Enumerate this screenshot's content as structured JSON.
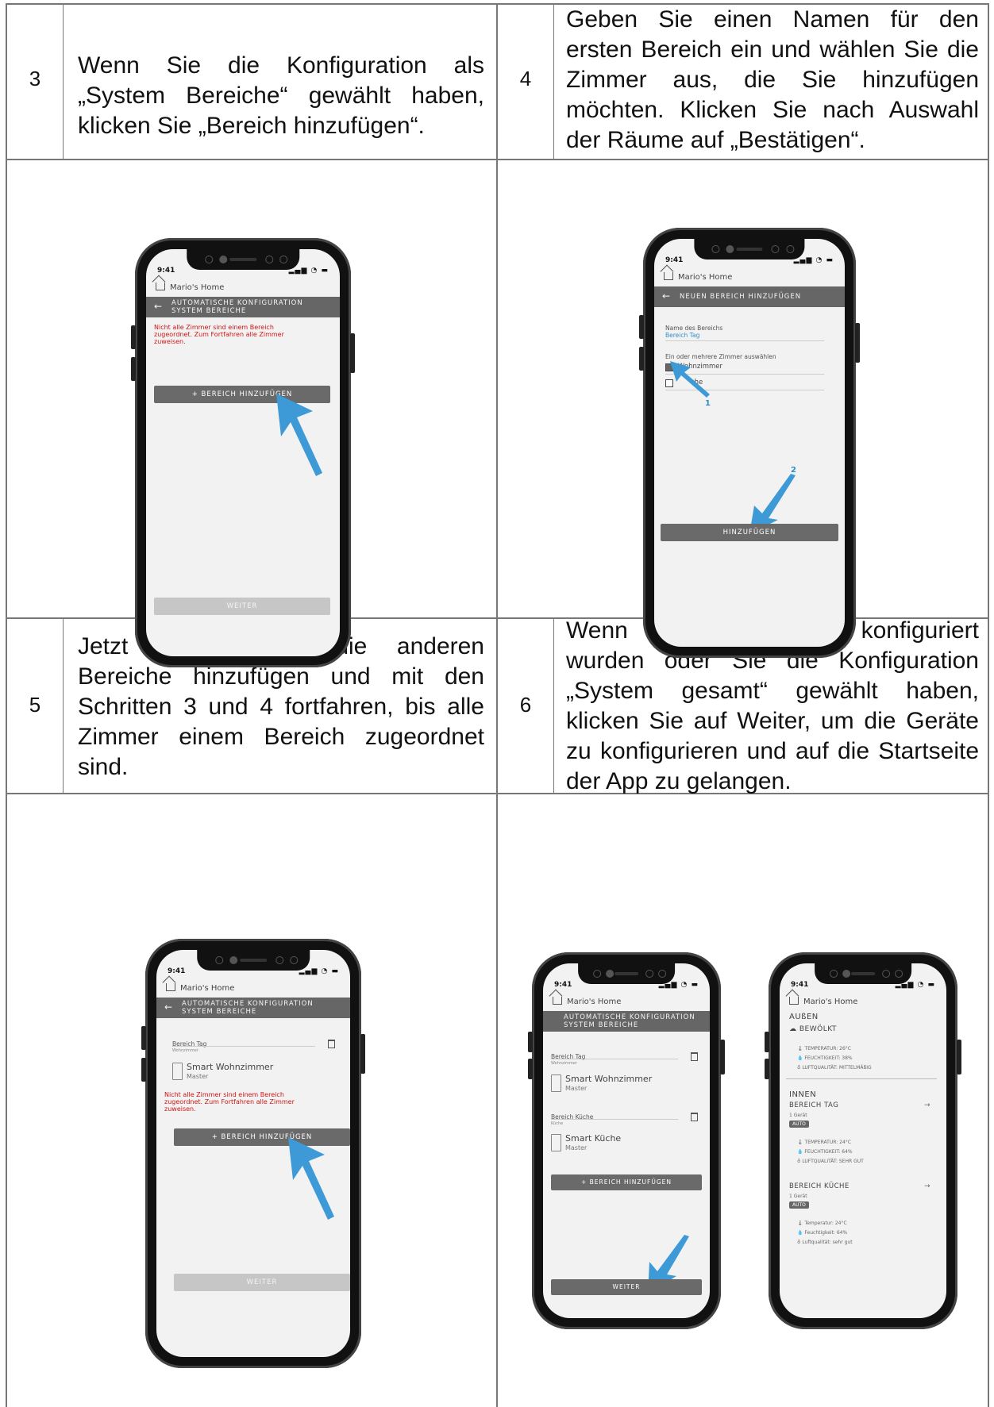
{
  "steps": [
    {
      "num": "3",
      "text": "Wenn Sie die Konfiguration als „System Bereiche“ gewählt haben, klicken Sie „Bereich hinzufügen“."
    },
    {
      "num": "4",
      "text": "Geben Sie einen Namen für den ersten Bereich ein und wählen Sie die Zimmer aus, die Sie hinzufügen möchten. Klicken Sie nach Auswahl der Räume auf „Bestätigen“."
    },
    {
      "num": "5",
      "text": "Jetzt müssen Sie die anderen Bereiche hinzufügen und mit den Schritten 3 und 4 fortfahren, bis alle Zimmer einem Bereich zugeordnet sind."
    },
    {
      "num": "6",
      "text": "Wenn alle Bereiche konfiguriert wurden oder Sie die Konfiguration „System gesamt“ gewählt haben, klicken Sie auf Weiter, um die Geräte zu konfigurieren und auf die Startseite der App zu gelangen."
    }
  ],
  "phone": {
    "time": "9:41",
    "status_icons": "▂▄▆ ◔ ▬",
    "home": "Mario's Home",
    "back": "←",
    "auto_title_1": "AUTOMATISCHE KONFIGURATION",
    "auto_title_2": "SYSTEM BEREICHE",
    "warning_1": "Nicht alle Zimmer sind einem Bereich",
    "warning_2": "zugeordnet. Zum Fortfahren alle Zimmer",
    "warning_3": "zuweisen.",
    "add_area": "+ BEREICH HINZUFÜGEN",
    "next": "WEITER"
  },
  "phone2": {
    "title": "NEUEN BEREICH HINZUFÜGEN",
    "name_label": "Name des Bereichs",
    "name_value": "Bereich Tag",
    "rooms_label": "Ein oder mehrere Zimmer auswählen",
    "room1": "Wohnzimmer",
    "room2": "Küche",
    "room2_visible": "che",
    "marker1": "1",
    "marker2": "2",
    "submit": "HINZUFÜGEN"
  },
  "areas": {
    "tag": "Bereich Tag",
    "tag_sub": "Wohnzimmer",
    "tag_device": "Smart Wohnzimmer",
    "master": "Master",
    "kueche": "Bereich Küche",
    "kueche_sub": "Küche",
    "kueche_device": "Smart Küche"
  },
  "dashboard": {
    "outside": "AUßEN",
    "weather": "BEWÖLKT",
    "temp_out": "TEMPERATUR: 26°C",
    "hum_out": "FEUCHTIGKEIT: 38%",
    "air_out": "LUFTQUALITÄT: MITTELMÄßIG",
    "inside": "INNEN",
    "area_tag": "BEREICH TAG",
    "devices": "1 Gerät",
    "auto": "AUTO",
    "temp_tag": "TEMPERATUR: 24°C",
    "hum_tag": "FEUCHTIGKEIT: 64%",
    "air_tag": "LUFTQUALITÄT: SEHR GUT",
    "area_kueche": "BEREICH KÜCHE",
    "temp_k": "Temperatur: 24°C",
    "hum_k": "Feuchtigkeit: 64%",
    "air_k": "Luftqualität: sehr gut",
    "chevron": "→"
  },
  "colors": {
    "arrow": "#3d9ad6",
    "warning": "#d01515",
    "header": "#666666"
  }
}
